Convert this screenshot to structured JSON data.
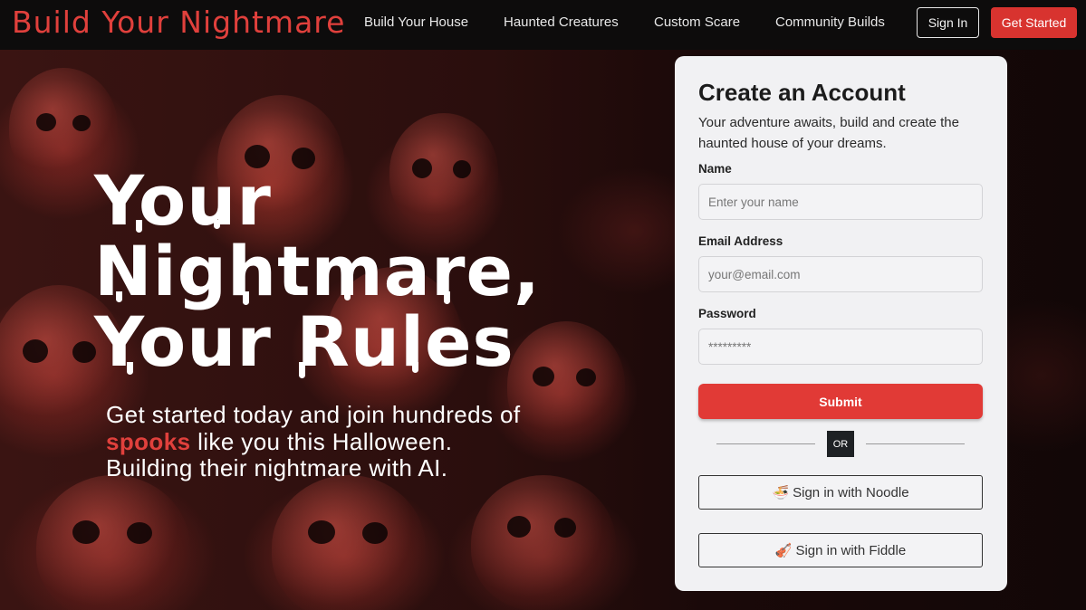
{
  "nav": {
    "brand": "Build Your Nightmare",
    "links": [
      "Build Your House",
      "Haunted Creatures",
      "Custom Scare",
      "Community Builds"
    ],
    "sign_in": "Sign In",
    "get_started": "Get Started"
  },
  "hero": {
    "title_lines": [
      "Your",
      "Nightmare,",
      "Your Rules"
    ],
    "subtitle_before": "Get started today and join hundreds of",
    "subtitle_accent": "spooks",
    "subtitle_after": "like you this Halloween. Building their nightmare with AI."
  },
  "card": {
    "title": "Create an Account",
    "description": "Your adventure awaits, build and create the haunted house of your dreams.",
    "name_label": "Name",
    "name_placeholder": "Enter your name",
    "email_label": "Email Address",
    "email_placeholder": "your@email.com",
    "password_label": "Password",
    "password_placeholder": "*********",
    "submit": "Submit",
    "or": "OR",
    "oauth_noodle": "Sign in with Noodle",
    "oauth_noodle_icon": "🍜",
    "oauth_fiddle": "Sign in with Fiddle",
    "oauth_fiddle_icon": "🎻"
  },
  "colors": {
    "accent": "#e0403c",
    "button_red": "#d8332f",
    "card_bg": "#f1f1f3"
  }
}
